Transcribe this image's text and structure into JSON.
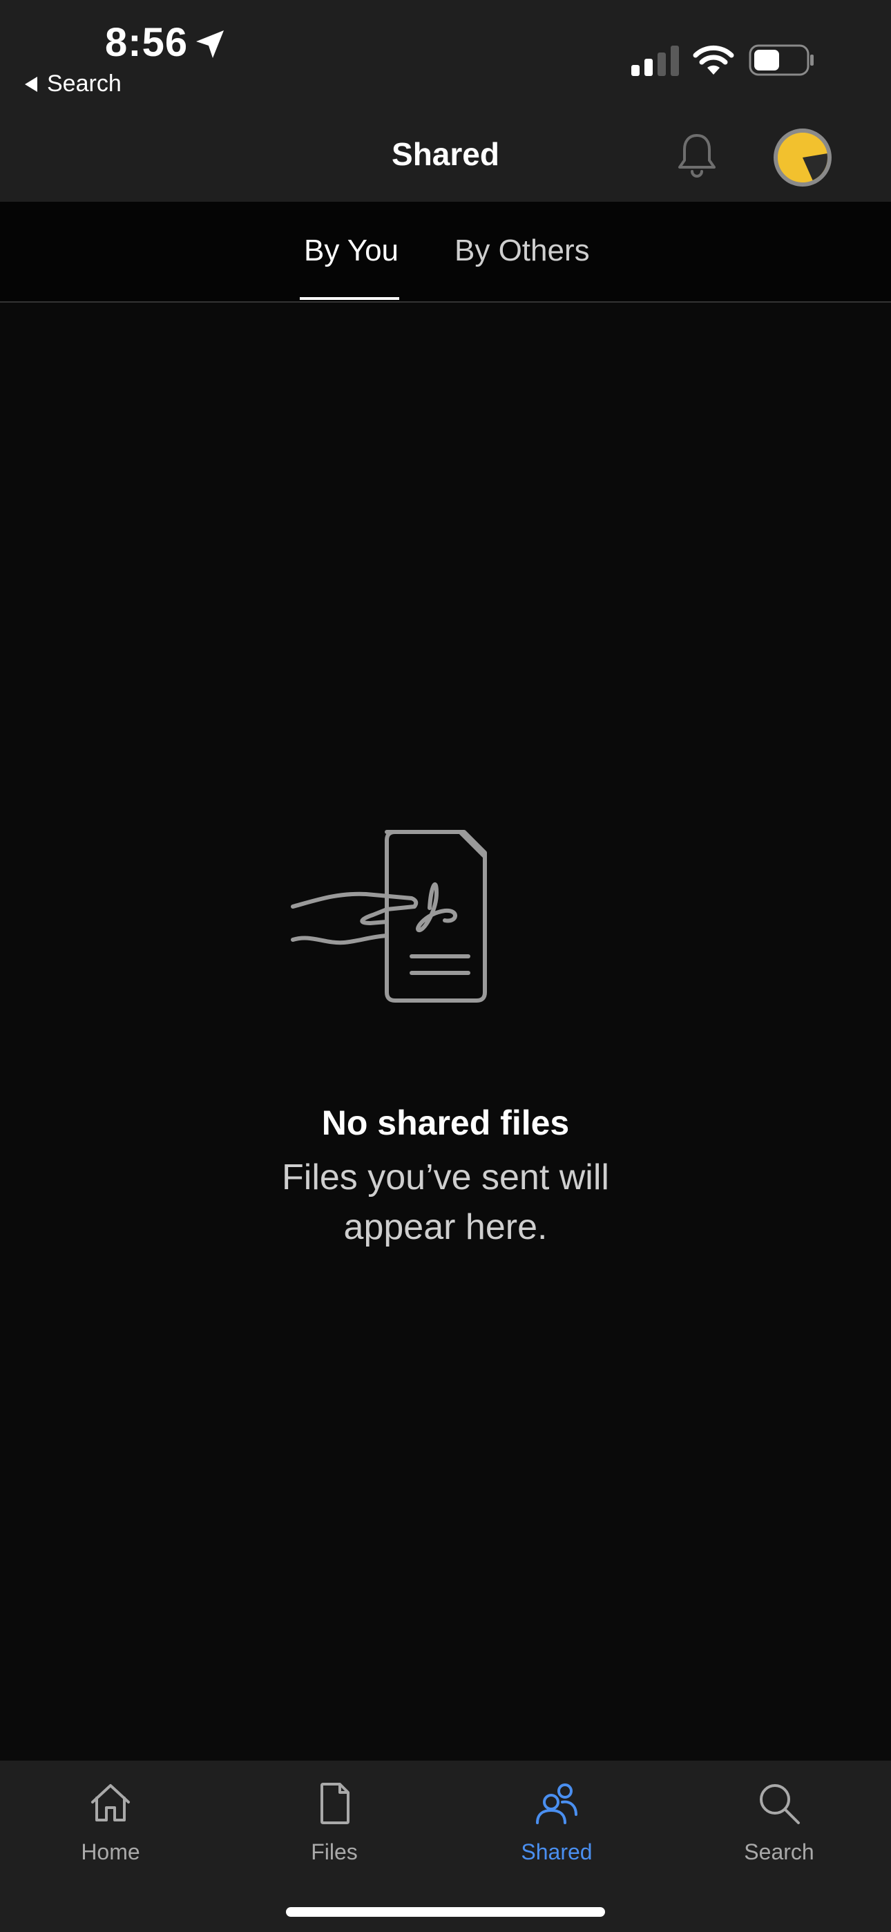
{
  "status_bar": {
    "time": "8:56",
    "back_label": "Search"
  },
  "header": {
    "title": "Shared"
  },
  "tabs": [
    {
      "label": "By You",
      "active": true
    },
    {
      "label": "By Others",
      "active": false
    }
  ],
  "empty_state": {
    "title": "No shared files",
    "subtitle": "Files you’ve sent will appear here."
  },
  "bottom_nav": [
    {
      "label": "Home",
      "icon": "home-icon",
      "active": false
    },
    {
      "label": "Files",
      "icon": "file-icon",
      "active": false
    },
    {
      "label": "Shared",
      "icon": "shared-people-icon",
      "active": true
    },
    {
      "label": "Search",
      "icon": "search-icon",
      "active": false
    }
  ],
  "colors": {
    "accent": "#4a8ff0",
    "avatar": "#f2c12e",
    "background": "#0a0a0a",
    "bar": "#1f1f1f"
  }
}
